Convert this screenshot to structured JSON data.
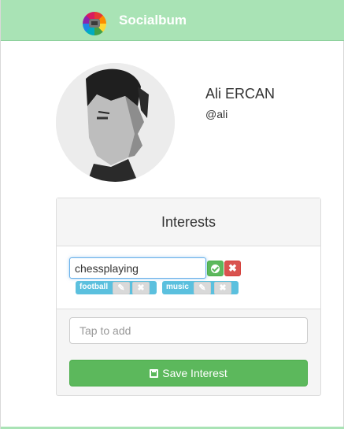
{
  "navbar": {
    "brand": "Socialbum",
    "logo_icon": "camera-logo-icon",
    "color": "#a9e3b5"
  },
  "profile": {
    "name": "Ali ERCAN",
    "username": "@ali"
  },
  "interests": {
    "title": "Interests",
    "edit_value": "chessplaying",
    "tags": [
      {
        "label": "football"
      },
      {
        "label": "music"
      }
    ],
    "add_placeholder": "Tap to add",
    "save_label": "Save Interest"
  },
  "colors": {
    "success": "#5cb85c",
    "danger": "#d9534f",
    "info": "#5bc0de"
  }
}
